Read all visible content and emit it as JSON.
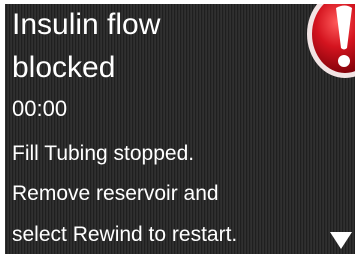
{
  "alert": {
    "title_line1": "Insulin flow",
    "title_line2": "blocked",
    "timer": "00:00",
    "message_lines": [
      "Fill Tubing stopped.",
      "Remove reservoir and",
      "select Rewind to restart."
    ],
    "icon": "exclamation-alert-icon",
    "scroll_icon": "down-arrow-icon"
  },
  "colors": {
    "background": "#2b2b2b",
    "text": "#ffffff",
    "alert_red": "#c8101e"
  }
}
